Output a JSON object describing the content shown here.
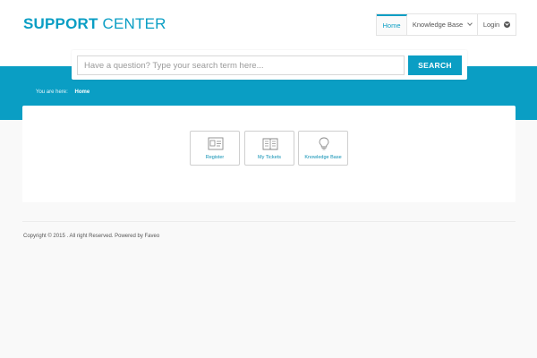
{
  "brand": {
    "bold": "SUPPORT",
    "regular": "CENTER"
  },
  "nav": {
    "home": "Home",
    "knowledge_base": "Knowledge Base",
    "login": "Login"
  },
  "search": {
    "placeholder": "Have a question? Type your search term here...",
    "value": "",
    "button": "SEARCH"
  },
  "breadcrumb": {
    "prefix": "You are here:",
    "current": "Home"
  },
  "tiles": [
    {
      "label": "Register",
      "icon": "id-card-icon"
    },
    {
      "label": "My Tickets",
      "icon": "book-icon"
    },
    {
      "label": "Knowledge Base",
      "icon": "lightbulb-icon"
    }
  ],
  "footer": {
    "text": "Copyright © 2015 . All right Reserved. Powered by Faveo"
  },
  "colors": {
    "accent": "#0a9ec4",
    "background": "#f9f9f9"
  }
}
